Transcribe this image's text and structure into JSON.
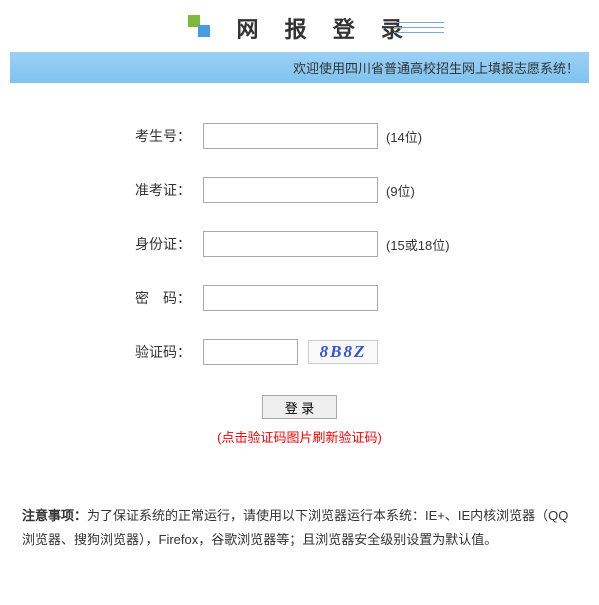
{
  "header": {
    "title": "网 报 登 录"
  },
  "banner": {
    "text": "欢迎使用四川省普通高校招生网上填报志愿系统！"
  },
  "form": {
    "examinee_no": {
      "label": "考生号：",
      "hint": "(14位)"
    },
    "admission_ticket": {
      "label": "准考证：",
      "hint": "(9位)"
    },
    "id_card": {
      "label": "身份证：",
      "hint": "(15或18位)"
    },
    "password": {
      "label": "密　码："
    },
    "captcha": {
      "label": "验证码：",
      "image_text": "8B8Z"
    }
  },
  "buttons": {
    "login": "登 录"
  },
  "hints": {
    "captcha_refresh": "(点击验证码图片刷新验证码)"
  },
  "notice": {
    "label": "注意事项：",
    "text": "为了保证系统的正常运行，请使用以下浏览器运行本系统：IE+、IE内核浏览器（QQ浏览器、搜狗浏览器），Firefox，谷歌浏览器等；且浏览器安全级别设置为默认值。"
  }
}
